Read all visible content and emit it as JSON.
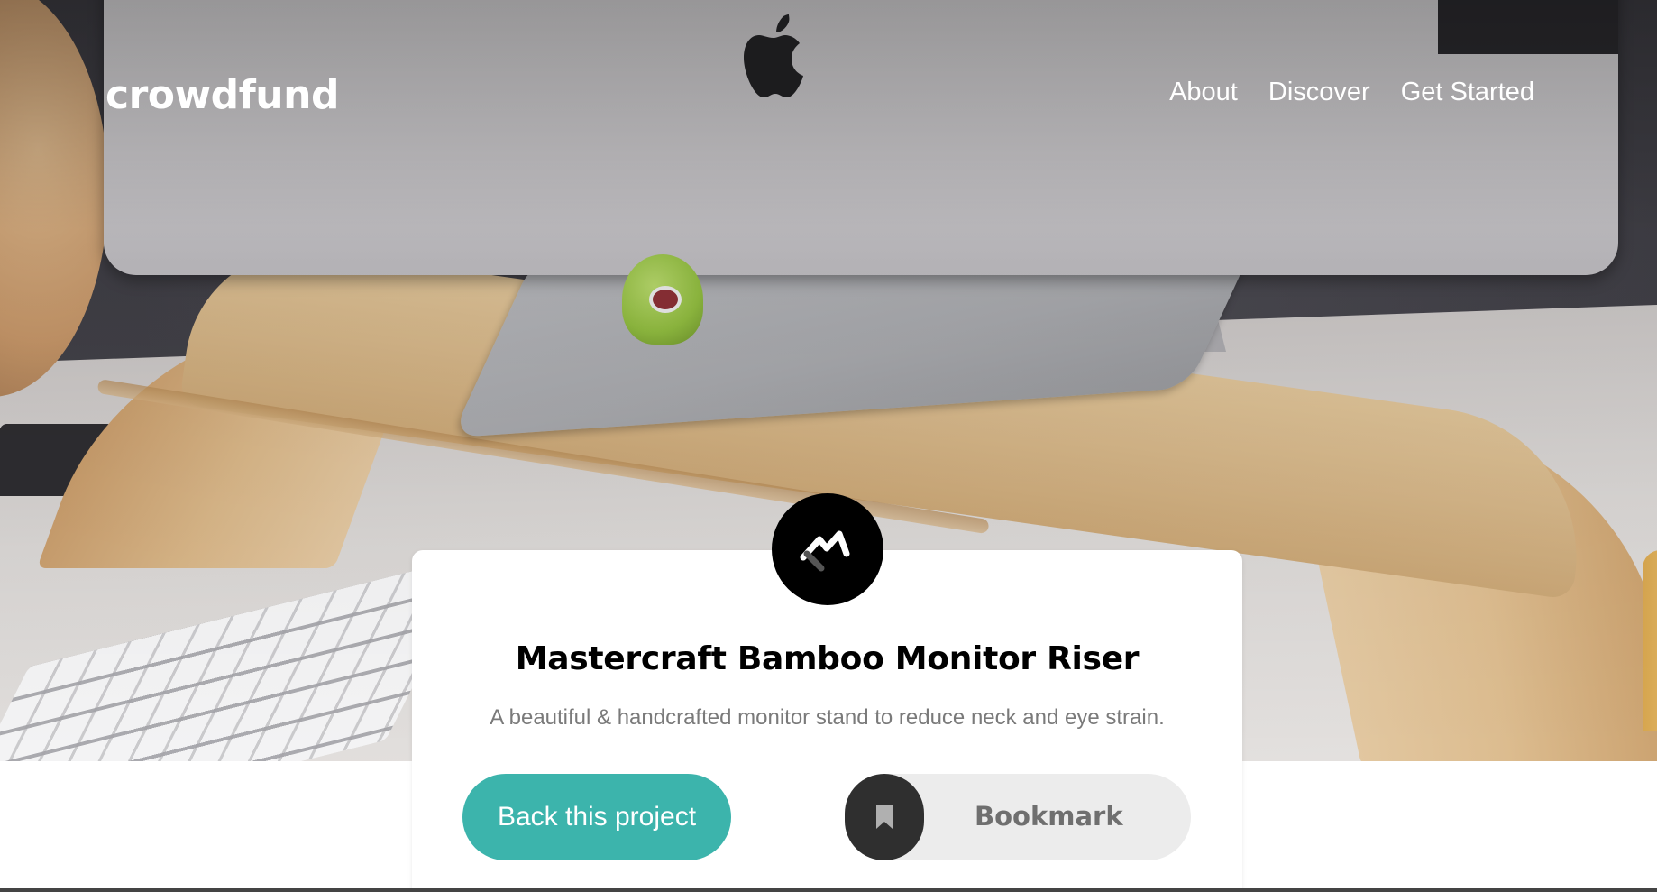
{
  "header": {
    "brand": "crowdfund",
    "nav": [
      {
        "label": "About"
      },
      {
        "label": "Discover"
      },
      {
        "label": "Get Started"
      }
    ]
  },
  "hero": {
    "image_description": "hero-photo"
  },
  "project": {
    "logo_icon": "mastercraft-logo-icon",
    "title": "Mastercraft Bamboo Monitor Riser",
    "description": "A beautiful & handcrafted monitor stand to reduce neck and eye strain.",
    "back_label": "Back this project",
    "bookmark_label": "Bookmark",
    "bookmark_icon": "bookmark-icon"
  },
  "colors": {
    "accent": "#3cb4ac",
    "bookmark_circle": "#2f2f2f",
    "bookmark_bg": "#ececec",
    "title": "#000000",
    "muted": "#7a7a7a"
  }
}
